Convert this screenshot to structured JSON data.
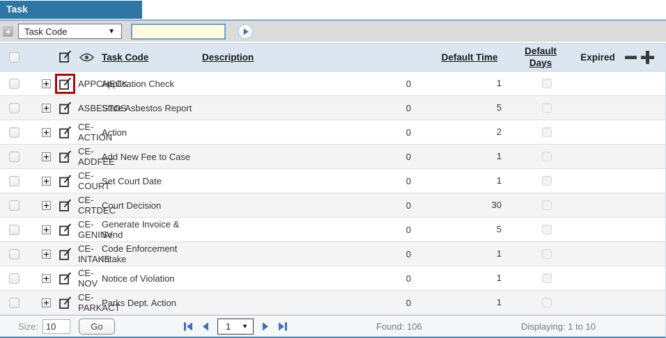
{
  "title": "Task",
  "toolbar": {
    "filter_dropdown": {
      "selected": "Task Code"
    },
    "search_input": {
      "value": ""
    },
    "icons": {
      "add_criteria": "plus-icon",
      "run_search": "play-icon"
    }
  },
  "table": {
    "headers": {
      "task_code": "Task Code",
      "description": "Description",
      "default_time": "Default Time",
      "default_days": "Default Days",
      "expired": "Expired"
    },
    "header_icons": {
      "edit": "edit-icon",
      "view": "eye-icon",
      "remove_column": "minus-icon",
      "add_column": "plus-icon"
    },
    "rows": [
      {
        "task_code": "APPCHECK",
        "description": "Application Check",
        "default_time": "0",
        "default_days": "1",
        "expired": false,
        "edit_icon_highlighted": true
      },
      {
        "task_code": "ASBESTOS",
        "description": "State Asbestos Report",
        "default_time": "0",
        "default_days": "5",
        "expired": false
      },
      {
        "task_code": "CE-ACTION",
        "description": "Action",
        "default_time": "0",
        "default_days": "2",
        "expired": false
      },
      {
        "task_code": "CE-ADDFEE",
        "description": "Add New Fee to Case",
        "default_time": "0",
        "default_days": "1",
        "expired": false
      },
      {
        "task_code": "CE-COURT",
        "description": "Set Court Date",
        "default_time": "0",
        "default_days": "1",
        "expired": false
      },
      {
        "task_code": "CE-CRTDEC",
        "description": "Court Decision",
        "default_time": "0",
        "default_days": "30",
        "expired": false
      },
      {
        "task_code": "CE-GENINV",
        "description": "Generate Invoice & Send",
        "default_time": "0",
        "default_days": "5",
        "expired": false
      },
      {
        "task_code": "CE-INTAKE",
        "description": "Code Enforcement Intake",
        "default_time": "0",
        "default_days": "1",
        "expired": false
      },
      {
        "task_code": "CE-NOV",
        "description": "Notice of Violation",
        "default_time": "0",
        "default_days": "1",
        "expired": false
      },
      {
        "task_code": "CE-PARKACT",
        "description": "Parks Dept. Action",
        "default_time": "0",
        "default_days": "1",
        "expired": false
      }
    ]
  },
  "footer": {
    "size_label": "Size:",
    "size_value": "10",
    "go_label": "Go",
    "page_value": "1",
    "found_text": "Found: 106",
    "displaying_text": "Displaying: 1 to 10",
    "pager_icons": {
      "first": "first-page-icon",
      "prev": "previous-page-icon",
      "next": "next-page-icon",
      "last": "last-page-icon"
    }
  },
  "colors": {
    "title_bar": "#2E76A4",
    "table_header_bg": "#DBE6F1",
    "row_alt_bg": "#F4F4F4",
    "search_input_bg": "#FFFDDE",
    "highlight_box": "#C00000",
    "pager_icon_blue": "#3E6FBF"
  }
}
